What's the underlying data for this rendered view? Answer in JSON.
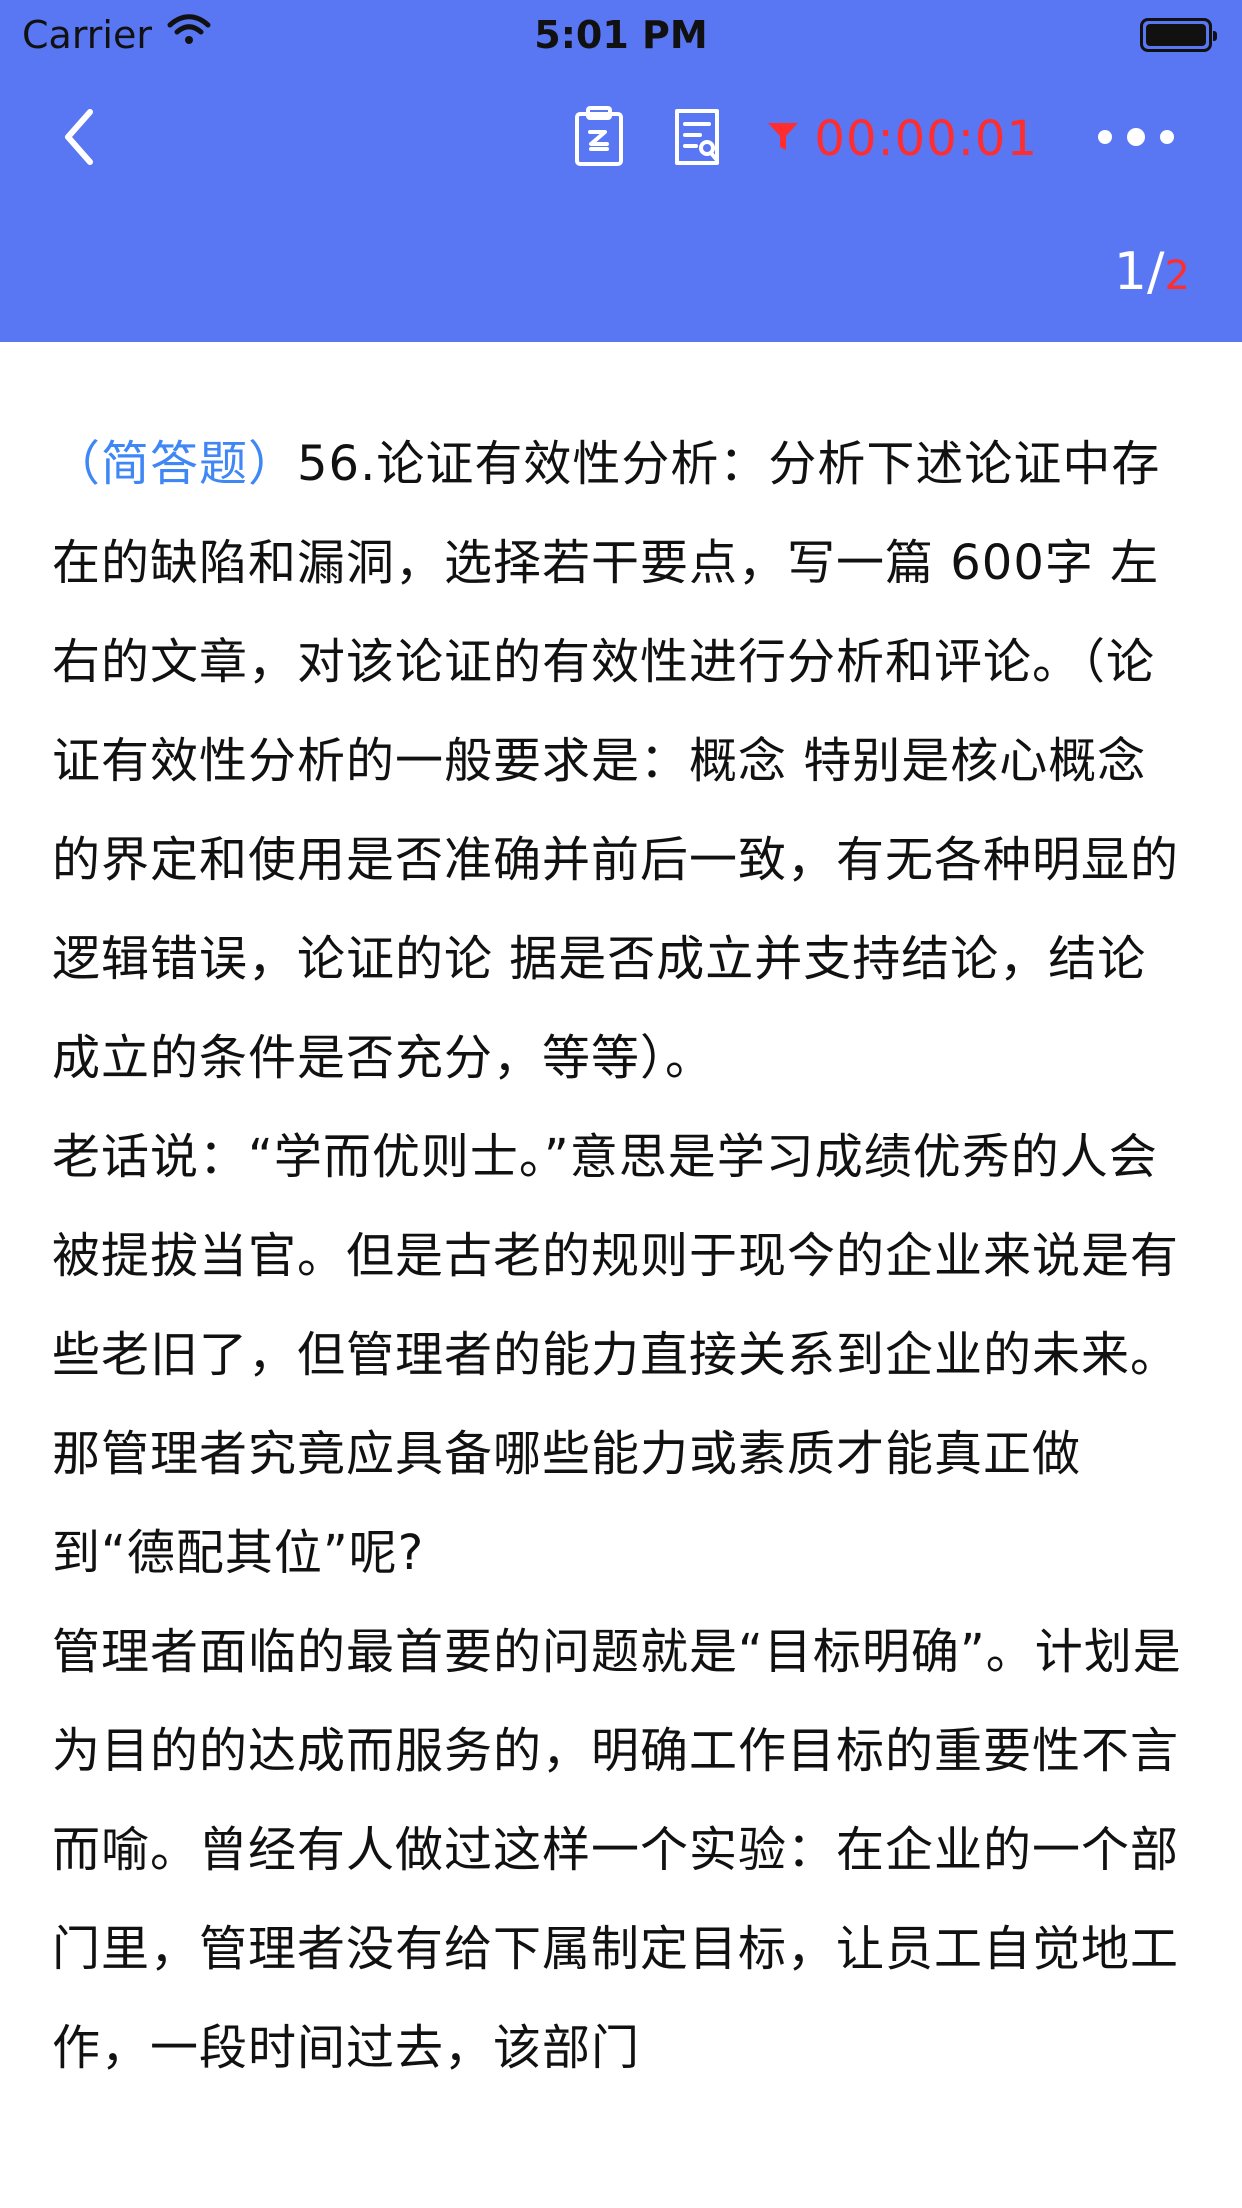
{
  "status_bar": {
    "carrier": "Carrier",
    "time": "5:01 PM"
  },
  "toolbar": {
    "icons": {
      "back": "chevron-left-icon",
      "clipboard": "clipboard-icon",
      "note": "document-note-icon",
      "funnel": "funnel-icon",
      "more": "more-icon"
    },
    "timer": "00:00:01",
    "page_current": "1",
    "page_separator": "/",
    "page_total": "2"
  },
  "question": {
    "type_label": "（简答题）",
    "intro": "56.论证有效性分析：分析下述论证中存在的缺陷和漏洞，选择若干要点，写一篇 600字 左右的文章，对该论证的有效性进行分析和评论。（论证有效性分析的一般要求是：概念 特别是核心概念的界定和使用是否准确并前后一致，有无各种明显的逻辑错误，论证的论 据是否成立并支持结论，结论成立的条件是否充分，等等）。",
    "paragraph_2": "老话说：“学而优则士。”意思是学习成绩优秀的人会被提拔当官。但是古老的规则于现今的企业来说是有些老旧了，但管理者的能力直接关系到企业的未来。那管理者究竟应具备哪些能力或素质才能真正做到“德配其位”呢?",
    "paragraph_3": "管理者面临的最首要的问题就是“目标明确”。计划是为目的的达成而服务的，明确工作目标的重要性不言而喻。曾经有人做过这样一个实验：在企业的一个部门里，管理者没有给下属制定目标，让员工自觉地工作，一段时间过去，该部门"
  },
  "colors": {
    "header_bg": "#5977f2",
    "timer_red": "#ff2d2d",
    "question_type_blue": "#3f87f5"
  }
}
